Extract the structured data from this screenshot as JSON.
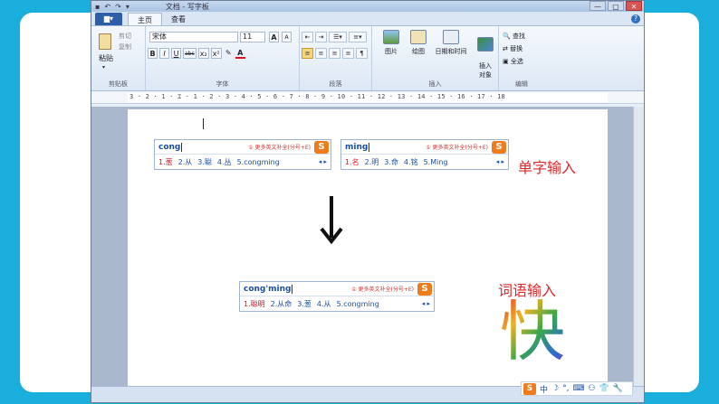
{
  "window": {
    "title": "文档 - 写字板",
    "quick_access": [
      "▪",
      "↶",
      "↷",
      "▾"
    ],
    "controls": [
      "—",
      "▢",
      "✕"
    ]
  },
  "tabs": {
    "menu": "▆▾",
    "items": [
      "主页",
      "查看"
    ],
    "active": "主页",
    "help": "?"
  },
  "ribbon": {
    "clipboard": {
      "paste": "粘贴",
      "cut": "剪切",
      "copy": "复制",
      "label": "剪贴板"
    },
    "font": {
      "family": "宋体",
      "size": "11",
      "grow": "A",
      "shrink": "A",
      "buttons": [
        "B",
        "I",
        "U",
        "abc",
        "x₂",
        "x²",
        "✎",
        "A"
      ],
      "label": "字体"
    },
    "paragraph": {
      "label": "段落"
    },
    "insert": {
      "items": [
        "图片",
        "绘图",
        "日期和时间",
        "插入\n对象"
      ],
      "label": "插入"
    },
    "edit": {
      "items": [
        "查找",
        "替换",
        "全选"
      ],
      "label": "编辑"
    }
  },
  "ruler": {
    "text": "3 · 2 · 1 · ⌶ · 1 · 2 · 3 · 4 · 5 · 6 · 7 · 8 · 9 · 10 · 11 · 12 · 13 · 14 · 15 · 16 · 17 · 18"
  },
  "ime_boxes": [
    {
      "pinyin": "cong",
      "hint": "① 更多英文补全(分号+E)",
      "candidates": [
        "1.葱",
        "2.从",
        "3.聪",
        "4.丛",
        "5.congming"
      ],
      "nav": "◂ ▸"
    },
    {
      "pinyin": "ming",
      "hint": "① 更多英文补全(分号+E)",
      "candidates": [
        "1.名",
        "2.明",
        "3.命",
        "4.铭",
        "5.Ming"
      ],
      "nav": "◂ ▸"
    },
    {
      "pinyin": "cong'ming",
      "hint": "① 更多英文补全(分号+E)",
      "candidates": [
        "1.聪明",
        "2.从命",
        "3.葱",
        "4.从",
        "5.congming"
      ],
      "nav": "◂ ▸"
    }
  ],
  "labels": {
    "single_char": "单字输入",
    "word": "词语输入",
    "kuai": "快"
  },
  "ime_logo": "S",
  "tray": [
    "S",
    "中",
    "☽",
    "°,",
    "⌨",
    "⚇",
    "👕",
    "🔧"
  ],
  "colors": {
    "background": "#1aaedc",
    "accent_red": "#e0262a",
    "ime_blue": "#1b4fa0",
    "sogou_orange": "#f07b1a"
  }
}
